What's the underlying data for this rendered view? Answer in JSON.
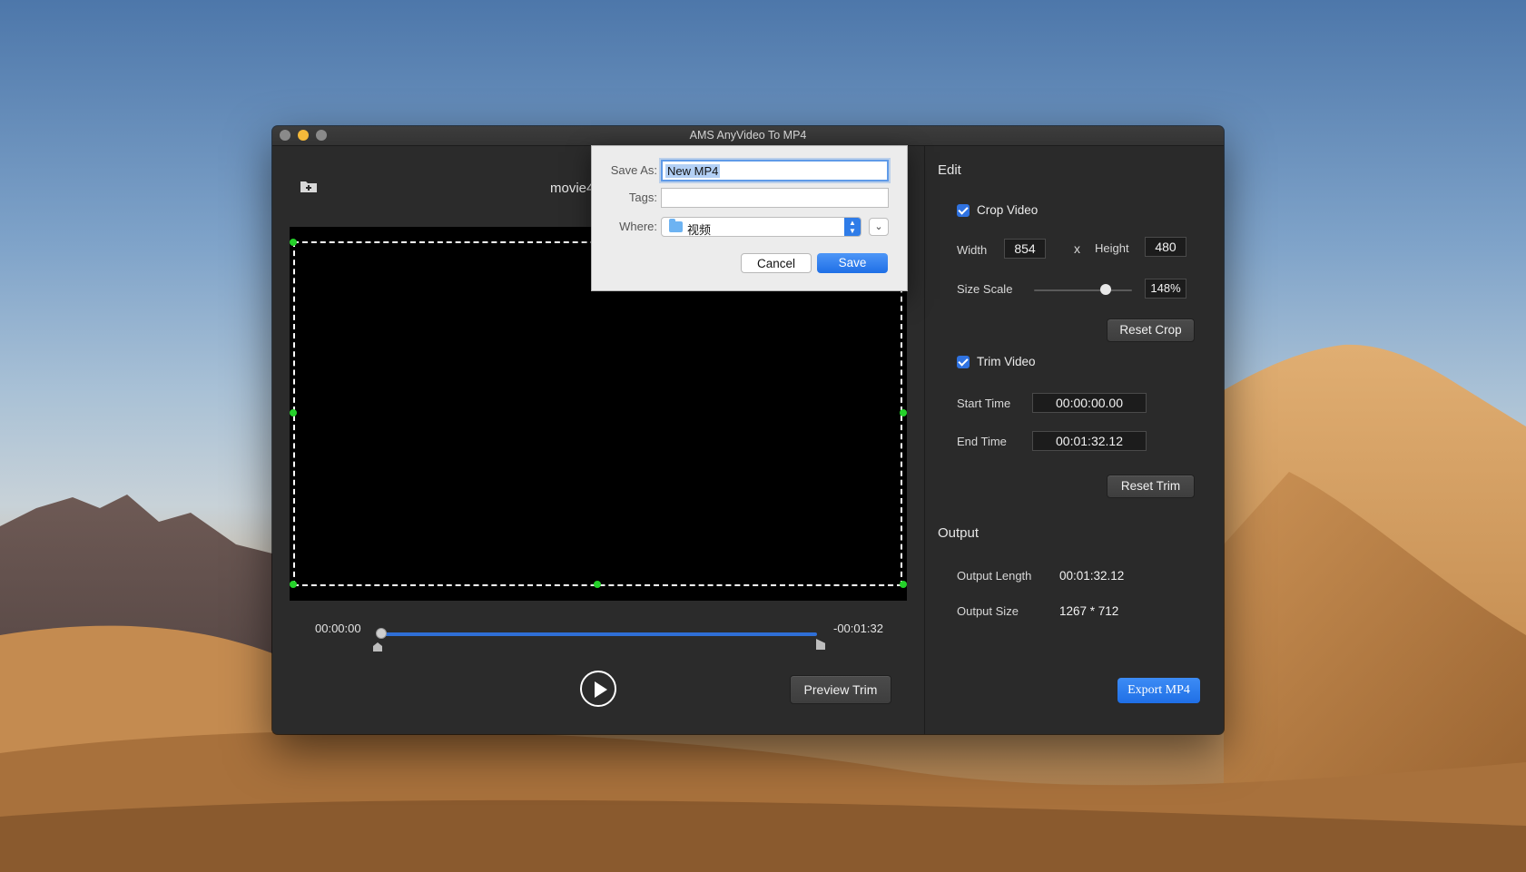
{
  "window": {
    "title": "AMS AnyVideo To MP4"
  },
  "player": {
    "file_name": "movie4",
    "time_start": "00:00:00",
    "time_end": "-00:01:32",
    "progress": 0.0,
    "preview_trim_label": "Preview Trim"
  },
  "edit": {
    "title": "Edit",
    "crop_video_label": "Crop Video",
    "crop_checked": true,
    "width_label": "Width",
    "width_value": "854",
    "x_label": "x",
    "height_label": "Height",
    "height_value": "480",
    "size_scale_label": "Size Scale",
    "size_scale_value": "148%",
    "reset_crop_label": "Reset Crop",
    "trim_video_label": "Trim Video",
    "trim_checked": true,
    "start_time_label": "Start Time",
    "start_time_value": "00:00:00.00",
    "end_time_label": "End Time",
    "end_time_value": "00:01:32.12",
    "reset_trim_label": "Reset Trim"
  },
  "output": {
    "title": "Output",
    "length_label": "Output Length",
    "length_value": "00:01:32.12",
    "size_label": "Output Size",
    "size_value": "1267 * 712",
    "export_label": "Export MP4"
  },
  "save_dialog": {
    "save_as_label": "Save As:",
    "save_as_value": "New MP4",
    "tags_label": "Tags:",
    "tags_value": "",
    "where_label": "Where:",
    "where_value": "视频",
    "cancel_label": "Cancel",
    "save_label": "Save"
  },
  "colors": {
    "accent": "#2f72e0",
    "crop_handle": "#25d12a",
    "window_bg": "#2b2b2b"
  },
  "icons": [
    "add-folder-icon",
    "folder-icon",
    "play-icon",
    "checkbox-icon",
    "chevron-down-icon",
    "updown-arrows-icon"
  ]
}
